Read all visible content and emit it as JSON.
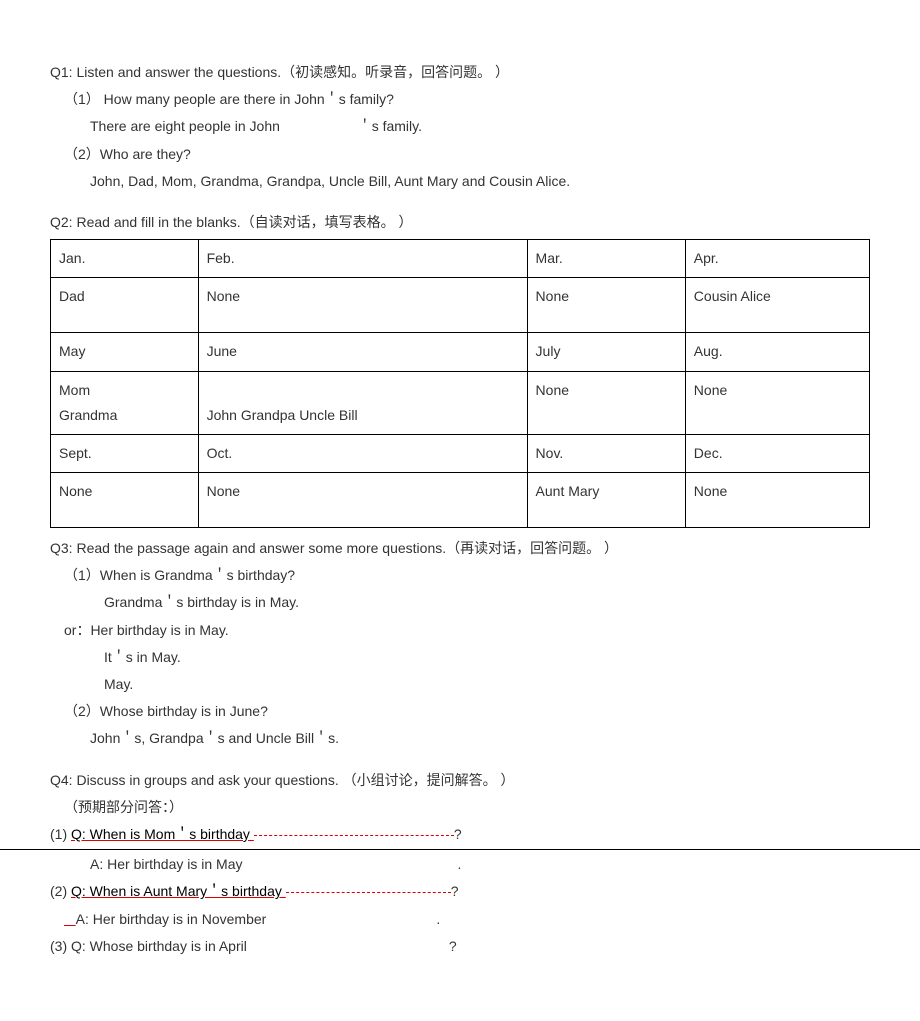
{
  "q1": {
    "title": "Q1: Listen and answer the questions.（初读感知。听录音，回答问题。  ）",
    "p1_q": "（1） How many people are there in John＇s family?",
    "p1_a_left": "There are eight people in John",
    "p1_a_right": "＇s family.",
    "p2_q": "（2）Who are they?",
    "p2_a": "John, Dad, Mom, Grandma, Grandpa, Uncle Bill, Aunt Mary and Cousin Alice."
  },
  "q2": {
    "title": "Q2: Read and fill in the blanks.（自读对话，填写表格。      ）",
    "rows": [
      [
        "Jan.",
        "Feb.",
        "Mar.",
        "Apr."
      ],
      [
        "Dad",
        "None",
        "None",
        "Cousin Alice"
      ],
      [
        "May",
        "June",
        "July",
        "Aug."
      ],
      [
        "Mom\nGrandma",
        "\nJohn Grandpa Uncle Bill",
        "None",
        "None"
      ],
      [
        "Sept.",
        "Oct.",
        "Nov.",
        "Dec."
      ],
      [
        "None",
        "None",
        "Aunt Mary",
        "None"
      ]
    ]
  },
  "q3": {
    "title": "Q3: Read the passage again and answer some more questions.（再读对话，回答问题。      ）",
    "p1_q": "（1）When is Grandma＇s birthday?",
    "p1_a1": "Grandma＇s birthday is in May.",
    "p1_a2": "or：Her birthday is in May.",
    "p1_a3": "It＇s in May.",
    "p1_a4": "May.",
    "p2_q": "（2）Whose birthday is in June?",
    "p2_a": "John＇s, Grandpa＇s and Uncle Bill＇s."
  },
  "q4": {
    "title": "Q4: Discuss in groups and ask your questions. （小组讨论，提问解答。  ）",
    "note": "（预期部分问答：）",
    "p1_q_label": "(1)  ",
    "p1_q_text": "Q: When is Mom＇s birthday ",
    "qmark": "?",
    "p1_a": "A: Her birthday is in May",
    "dot": ".",
    "p2_q_label": "(2)  ",
    "p2_q_text": "Q: When is Aunt Mary＇s birthday ",
    "p2_a": "A: Her birthday is in November",
    "p3_q_label": "(3)  Q: Whose birthday is in April"
  }
}
